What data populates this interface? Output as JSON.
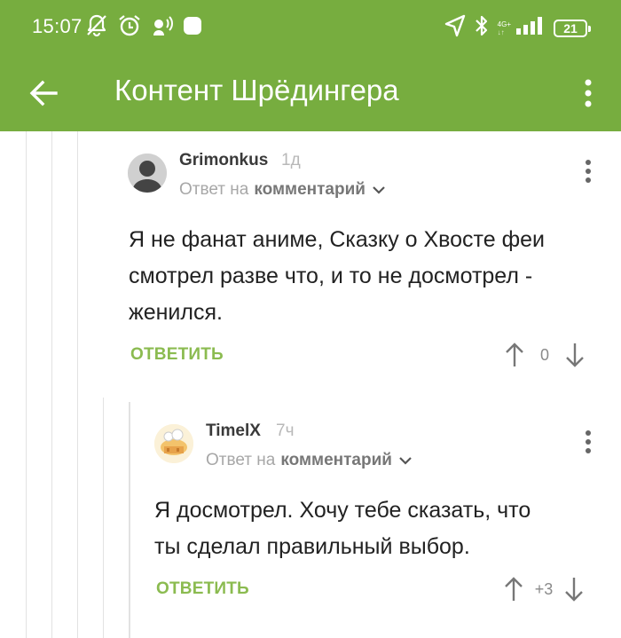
{
  "status_bar": {
    "time": "15:07",
    "battery": "21",
    "network": "4G+",
    "icons": [
      "mute-bell-icon",
      "alarm-icon",
      "speaker-icon",
      "app-notification-icon",
      "location-arrow-icon",
      "bluetooth-icon",
      "signal-icon",
      "battery-icon"
    ]
  },
  "app_bar": {
    "title": "Контент Шрёдингера",
    "back_icon": "arrow-left-icon",
    "menu_icon": "more-vertical-icon"
  },
  "colors": {
    "brand_green": "#77ad3f",
    "reply_green": "#8bbb50"
  },
  "comments": [
    {
      "username": "Grimonkus",
      "time": "1д",
      "reply_prefix": "Ответ на",
      "reply_target": "комментарий",
      "text_lines": [
        "Я не фанат аниме, Сказку о Хвосте феи",
        "смотрел разве что, и то не досмотрел -",
        "женился."
      ],
      "reply_label": "ОТВЕТИТЬ",
      "rating": "0"
    },
    {
      "username": "TimelX",
      "time": "7ч",
      "reply_prefix": "Ответ на",
      "reply_target": "комментарий",
      "text_lines": [
        "Я досмотрел. Хочу тебе сказать, что",
        "ты сделал правильный выбор."
      ],
      "reply_label": "ОТВЕТИТЬ",
      "rating": "+3"
    }
  ]
}
